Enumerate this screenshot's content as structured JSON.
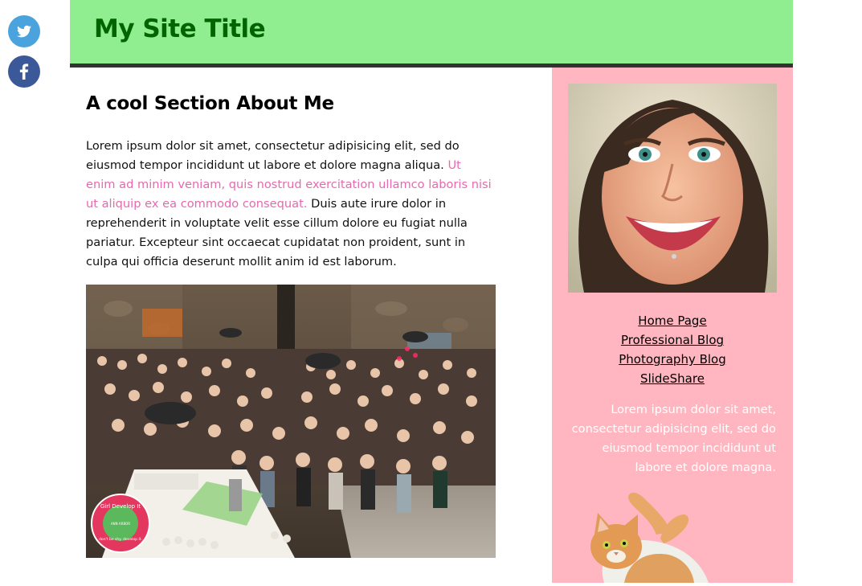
{
  "social": {
    "twitter_icon": "twitter-bird-icon",
    "facebook_icon": "facebook-f-icon",
    "twitter_color": "#4aa3dc",
    "facebook_color": "#3b5998"
  },
  "header": {
    "title": "My Site Title",
    "background": "#90ee90",
    "title_color": "#006400"
  },
  "main": {
    "section_title": "A cool Section About Me",
    "paragraph": {
      "part1": "Lorem ipsum dolor sit amet, consectetur adipisicing elit, sed do eiusmod tempor incididunt ut labore et dolore magna aliqua. ",
      "highlight": "Ut enim ad minim veniam, quis nostrud exercitation ullamco laboris nisi ut aliquip ex ea commodo consequat.",
      "part2": " Duis aute irure dolor in reprehenderit in voluptate velit esse cillum dolore eu fugiat nulla pariatur. Excepteur sint occaecat cupidatat non proident, sunt in culpa qui officia deserunt mollit anim id est laborum."
    },
    "highlight_color": "#e868b0",
    "photo": {
      "badge_text": "Girl Develop It",
      "badge_sub": "ANN ARBOR",
      "badge_tagline": "don't be shy. develop it."
    }
  },
  "sidebar": {
    "background": "#ffb6c1",
    "nav": [
      {
        "label": "Home Page"
      },
      {
        "label": "Professional Blog"
      },
      {
        "label": "Photography Blog"
      },
      {
        "label": "SlideShare"
      }
    ],
    "text": "Lorem ipsum dolor sit amet, consectetur adipisicing elit, sed do eiusmod tempor incididunt ut labore et dolore magna."
  }
}
